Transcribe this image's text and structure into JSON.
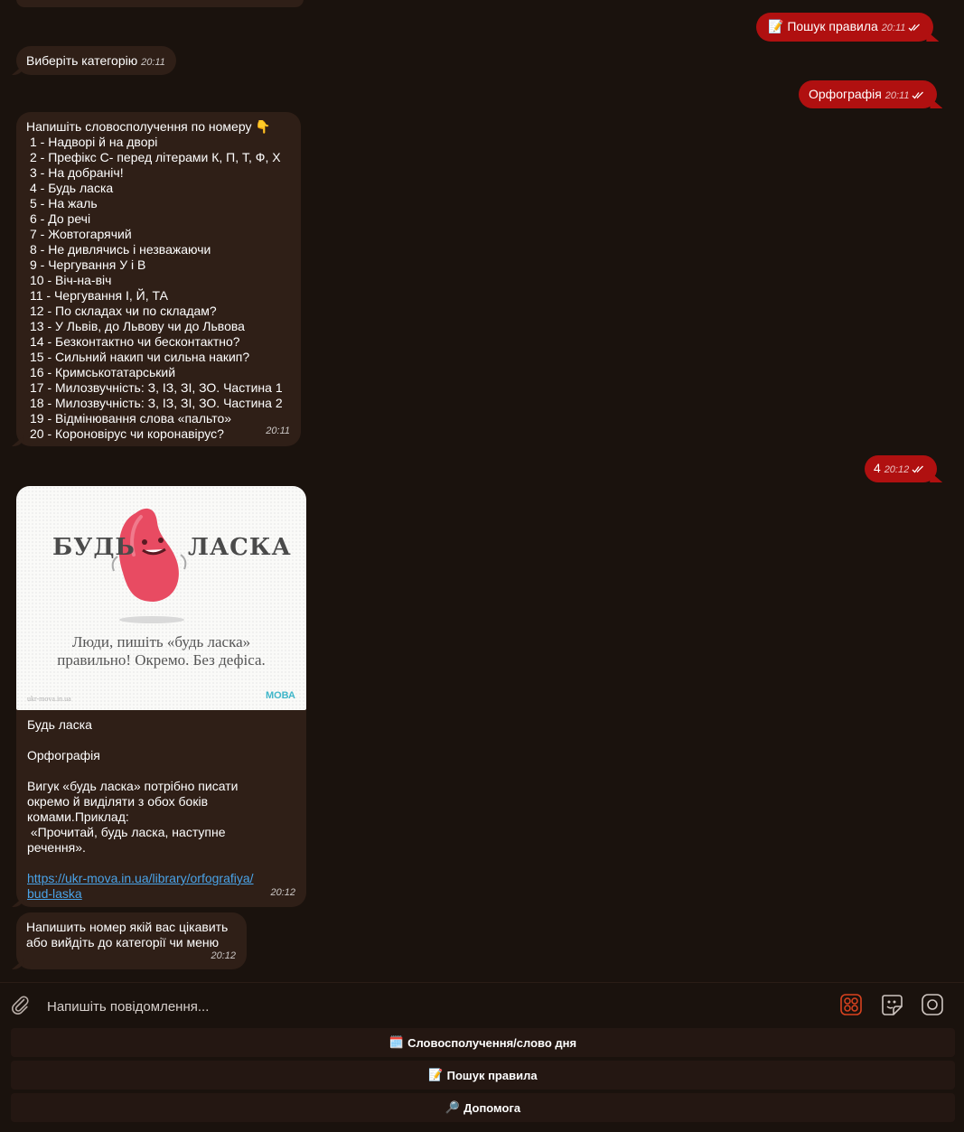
{
  "messages": {
    "out_search": {
      "emoji": "📝",
      "text": "Пошук правила",
      "time": "20:11"
    },
    "in_choose": {
      "text": "Виберіть категорію",
      "time": "20:11"
    },
    "out_category": {
      "text": "Орфографія",
      "time": "20:11"
    },
    "in_list": {
      "heading": "Напишіть словосполучення по номеру 👇",
      "items": [
        "1 - Надворі й на дворі",
        "2 - Префікс С- перед літерами К, П, Т, Ф, Х",
        "3 - На добраніч!",
        "4 - Будь ласка",
        "5 - На жаль",
        "6 - До речі",
        "7 - Жовтогарячий",
        "8 - Не дивлячись і незважаючи",
        "9 - Чергування У і В",
        "10 - Віч-на-віч",
        "11 - Чергування І, Й, ТА",
        "12 - По складах чи по складам?",
        "13 - У Львів, до Львову чи до Львова",
        "14 - Безконтактно чи бесконтактно?",
        "15 - Сильний накип чи сильна накип?",
        "16 - Кримськотатарський",
        "17 - Милозвучність: З, ІЗ, ЗІ, ЗО. Частина 1",
        "18 - Милозвучність: З, ІЗ, ЗІ, ЗО. Частина 2",
        "19 - Відмінювання слова «пальто»",
        "20 - Короновірус чи коронавірус?"
      ],
      "time": "20:11"
    },
    "out_number": {
      "text": "4",
      "time": "20:12"
    },
    "in_card": {
      "image": {
        "word_left": "БУДЬ",
        "word_right": "ЛАСКА",
        "caption_line1": "Люди, пишіть «будь ласка»",
        "caption_line2": "правильно! Окремо. Без дефіса.",
        "site": "ukr-mova.in.ua",
        "logo": "МОВА"
      },
      "title": "Будь ласка",
      "category": "Орфографія",
      "body_line1": "Вигук «будь ласка» потрібно писати",
      "body_line2": "окремо й виділяти з обох боків",
      "body_line3": "комами.Приклад:",
      "body_line4": " «Прочитай, будь ласка, наступне",
      "body_line5": "речення».",
      "link_line1": "https://ukr-mova.in.ua/library/orfografiya/",
      "link_line2": "bud-laska",
      "time": "20:12"
    },
    "in_prompt": {
      "line1": "Напишить номер якій вас цікавить",
      "line2": "або вийдіть до категорії чи меню",
      "time": "20:12"
    }
  },
  "composer": {
    "placeholder": "Напишіть повідомлення...",
    "icons": [
      "paperclip-icon",
      "bot-menu-icon",
      "sticker-icon",
      "camera-icon"
    ]
  },
  "keyboard": {
    "buttons": [
      {
        "emoji": "🗓️",
        "label": "Словосполучення/слово дня"
      },
      {
        "emoji": "📝",
        "label": "Пошук правила"
      },
      {
        "emoji": "🔎",
        "label": "Допомога"
      }
    ]
  },
  "colors": {
    "background": "#1a120d",
    "incoming": "#2f1f17",
    "outgoing": "#b01010",
    "link": "#4aa3e8"
  }
}
